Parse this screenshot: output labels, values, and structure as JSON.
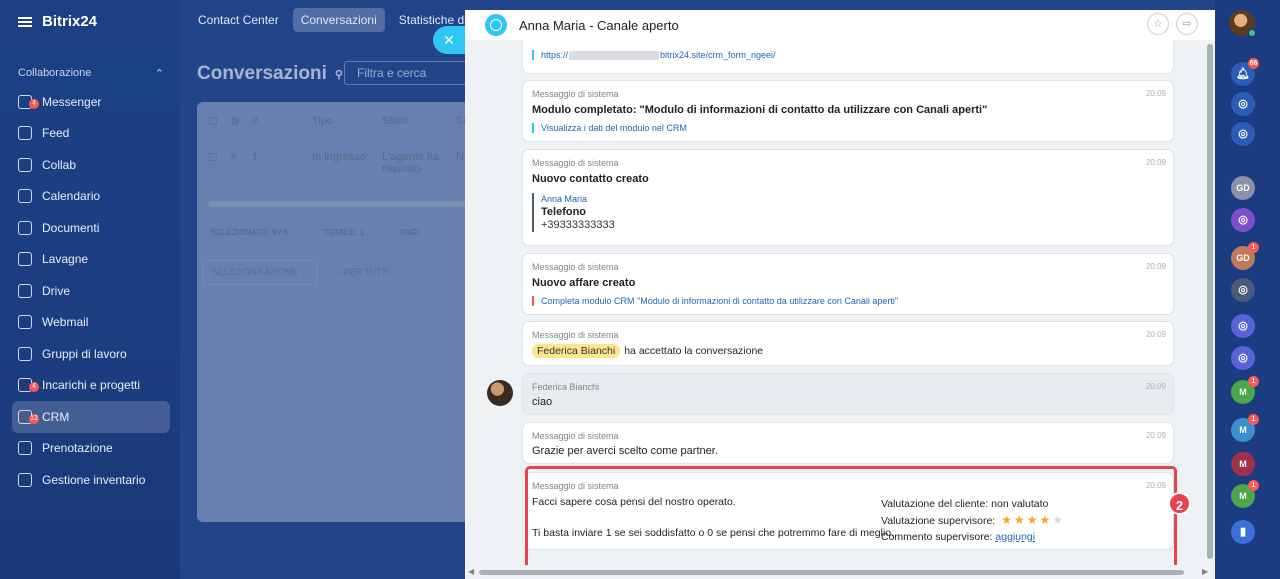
{
  "brand": {
    "name": "Bitrix24"
  },
  "sidebar": {
    "group_label": "Collaborazione",
    "items": [
      {
        "label": "Messenger",
        "icon": "chat-icon",
        "badge": "4"
      },
      {
        "label": "Feed",
        "icon": "feed-icon"
      },
      {
        "label": "Collab",
        "icon": "collab-icon"
      },
      {
        "label": "Calendario",
        "icon": "calendar-icon"
      },
      {
        "label": "Documenti",
        "icon": "document-icon"
      },
      {
        "label": "Lavagne",
        "icon": "board-icon"
      },
      {
        "label": "Drive",
        "icon": "drive-icon"
      },
      {
        "label": "Webmail",
        "icon": "mail-icon"
      },
      {
        "label": "Gruppi di lavoro",
        "icon": "group-icon"
      },
      {
        "label": "Incarichi e progetti",
        "icon": "task-icon",
        "badge": "4"
      },
      {
        "label": "CRM",
        "icon": "crm-icon",
        "badge": "12",
        "active": true
      },
      {
        "label": "Prenotazione",
        "icon": "booking-icon"
      },
      {
        "label": "Gestione inventario",
        "icon": "inventory-icon"
      }
    ]
  },
  "topbar": {
    "tabs": [
      {
        "label": "Contact Center"
      },
      {
        "label": "Conversazioni",
        "active": true
      },
      {
        "label": "Statistiche di co"
      }
    ]
  },
  "page": {
    "title": "Conversazioni",
    "filter_placeholder": "Filtra e cerca"
  },
  "grid": {
    "headers": [
      "#",
      "Tipo",
      "Stato",
      "Sr"
    ],
    "row": {
      "num": "1",
      "tipo": "In ingresso",
      "stato": "L'agente ha risposto",
      "extra": "N"
    },
    "footer": {
      "selected": "SELEZIONATO: 0 / 0",
      "total": "TOTALE: 1",
      "pages": "PAGI"
    },
    "actions": {
      "select_label": "SELEZIONA AZIONE",
      "all_label": "PER TUTTI"
    }
  },
  "chat": {
    "title": "Anna Maria - Canale aperto",
    "messages": [
      {
        "id": "link",
        "link_prefix": "https://",
        "link_suffix": "bitrix24.site/crm_form_ngeei/"
      },
      {
        "id": "form",
        "author": "Messaggio di sistema",
        "time": "20:09",
        "title": "Modulo completato: \"Modulo di informazioni di contatto da utilizzare con Canali aperti\"",
        "link": "Visualizza i dati del modulo nel CRM"
      },
      {
        "id": "contact",
        "author": "Messaggio di sistema",
        "time": "20:09",
        "title": "Nuovo contatto creato",
        "contact_name": "Anna Maria",
        "field_label": "Telefono",
        "field_value": "+39333333333"
      },
      {
        "id": "deal",
        "author": "Messaggio di sistema",
        "time": "20:09",
        "title": "Nuovo affare creato",
        "link": "Completa modulo CRM \"Modulo di informazioni di contatto da utilizzare con Canali aperti\""
      },
      {
        "id": "accepted",
        "author": "Messaggio di sistema",
        "time": "20:09",
        "mention": "Federica Bianchi",
        "text": "ha accettato la conversazione"
      },
      {
        "id": "user",
        "author": "Federica Bianchi",
        "time": "20:09",
        "text": "ciao"
      },
      {
        "id": "thanks",
        "author": "Messaggio di sistema",
        "time": "20:09",
        "text": "Grazie per averci scelto come partner."
      },
      {
        "id": "rating",
        "author": "Messaggio di sistema",
        "time": "20:09",
        "line1": "Facci sapere cosa pensi del nostro operato.",
        "line2": "Ti basta inviare 1 se sei soddisfatto o 0 se pensi che potremmo fare di meglio.",
        "client_label": "Valutazione del cliente:",
        "client_value": "non valutato",
        "supervisor_label": "Valutazione supervisore:",
        "supervisor_stars": 4,
        "supervisor_max": 5,
        "comment_label": "Commento supervisore:",
        "comment_action": "aggiungi"
      }
    ],
    "callout_number": "2"
  },
  "rightbar": {
    "items": [
      {
        "icon": "bell-icon",
        "badge": "66",
        "color": "#2b5cb8"
      },
      {
        "icon": "openline-icon",
        "color": "#2b5cb8"
      },
      {
        "icon": "chat-icon",
        "color": "#2b5cb8"
      },
      {
        "initials": "GD",
        "color": "#8c8fa8"
      },
      {
        "icon": "openline-icon",
        "color": "#7a4fc8"
      },
      {
        "initials": "GD",
        "badge": "1",
        "color": "#c07a5a"
      },
      {
        "icon": "avatar-icon",
        "color": "#4a5a78"
      },
      {
        "icon": "openline-icon",
        "color": "#5a62d8"
      },
      {
        "icon": "openline-icon",
        "color": "#5a62d8"
      },
      {
        "initials": "M",
        "badge": "1",
        "color": "#4aa64a"
      },
      {
        "initials": "M",
        "badge": "1",
        "color": "#3b8ed0"
      },
      {
        "initials": "M",
        "color": "#a0304a"
      },
      {
        "initials": "M",
        "badge": "1",
        "color": "#4aa64a"
      },
      {
        "icon": "bookmark-icon",
        "color": "#3d6fd8"
      }
    ]
  }
}
